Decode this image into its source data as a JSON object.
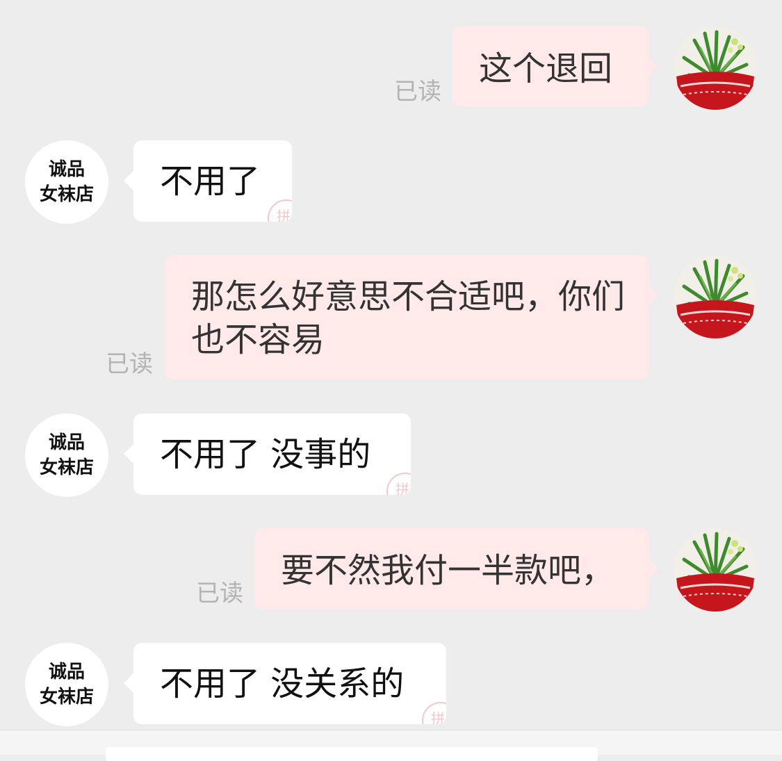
{
  "read_label": "已读",
  "shop_avatar": {
    "line1": "诚品",
    "line2": "女袜店"
  },
  "messages": [
    {
      "sender": "me",
      "text": "这个退回",
      "status": "已读"
    },
    {
      "sender": "shop",
      "text": "不用了"
    },
    {
      "sender": "me",
      "text": "那怎么好意思不合适吧，你们也不容易",
      "status": "已读"
    },
    {
      "sender": "shop",
      "text": "不用了 没事的"
    },
    {
      "sender": "me",
      "text": "要不然我付一半款吧，",
      "status": "已读"
    },
    {
      "sender": "shop",
      "text": "不用了 没关系的"
    }
  ],
  "colors": {
    "background": "#ededed",
    "sent_bubble": "#ffe9e9",
    "received_bubble": "#ffffff",
    "read_status": "#b3b3b3"
  },
  "icons": {
    "user_avatar": "potted-plant-avatar-icon",
    "merchant_stamp": "pin-stamp-icon"
  }
}
